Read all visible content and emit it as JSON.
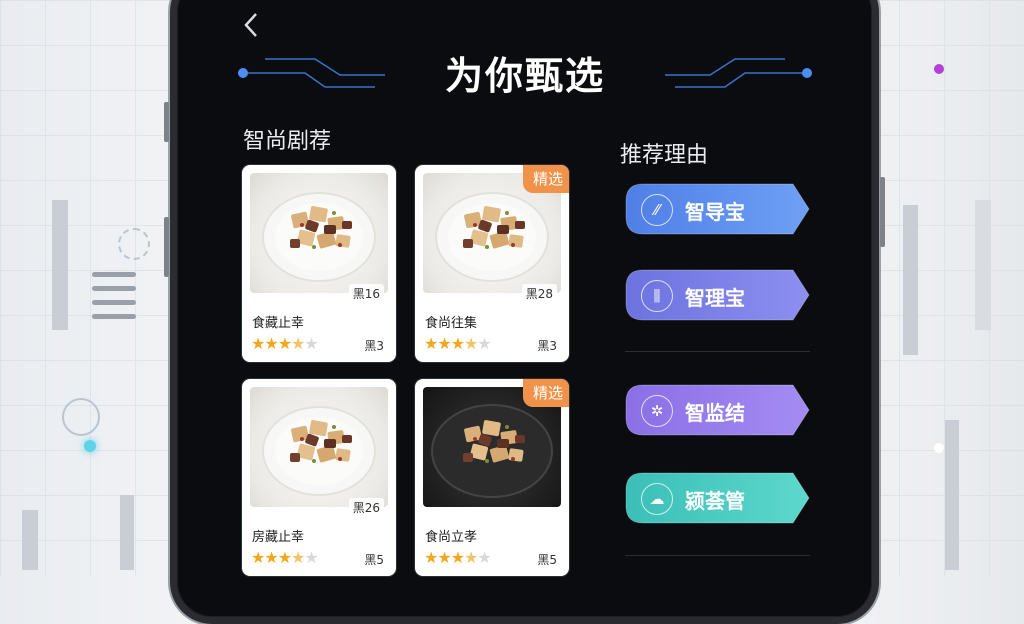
{
  "header": {
    "title": "为你甄选"
  },
  "recommend": {
    "title": "智尚剧荐",
    "cards": [
      {
        "name": "食藏止幸",
        "tag": "黑16",
        "score": "黑3",
        "rating": 3.5,
        "badge": "",
        "photo": "light"
      },
      {
        "name": "食尚往集",
        "tag": "黑28",
        "score": "黑3",
        "rating": 3.5,
        "badge": "精选",
        "photo": "light"
      },
      {
        "name": "房藏止幸",
        "tag": "黑26",
        "score": "黑5",
        "rating": 3.5,
        "badge": "",
        "photo": "light"
      },
      {
        "name": "食尚立孝",
        "tag": "",
        "score": "黑5",
        "rating": 3.5,
        "badge": "精选",
        "photo": "dark"
      }
    ]
  },
  "reasons": {
    "title": "推荐理由",
    "items": [
      {
        "label": "智导宝",
        "icon": "chart-pulse-icon",
        "glyph": "⁄⁄",
        "color_start": "#4f7fe6",
        "color_end": "#6fa0f5"
      },
      {
        "label": "智理宝",
        "icon": "bars-icon",
        "glyph": "⫼",
        "color_start": "#6c73df",
        "color_end": "#8d8ff0"
      },
      {
        "label": "智监结",
        "icon": "network-icon",
        "glyph": "✲",
        "color_start": "#8a6fe6",
        "color_end": "#a48cf3"
      },
      {
        "label": "颍荟管",
        "icon": "cloud-icon",
        "glyph": "☁",
        "color_start": "#3bbfb8",
        "color_end": "#5dd8cc"
      }
    ]
  }
}
